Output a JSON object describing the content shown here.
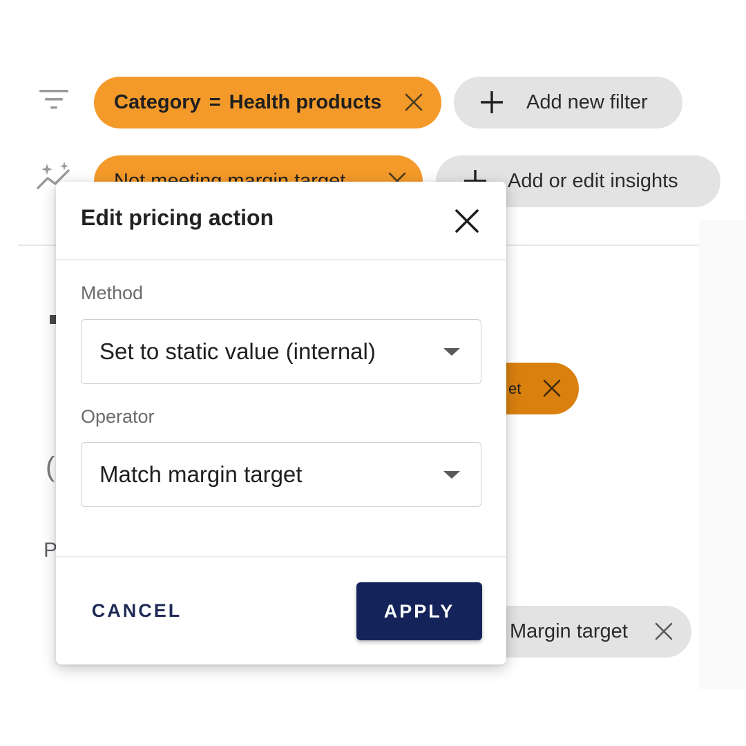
{
  "filters": {
    "chips": [
      {
        "field": "Category",
        "operator": "=",
        "value": "Health products"
      }
    ],
    "add_label": "Add new filter"
  },
  "insights": {
    "chips": [
      {
        "label": "Not meeting margin target"
      }
    ],
    "add_label": "Add or edit insights"
  },
  "background": {
    "chip_fragment": "et",
    "margin_chip_label": "Margin target",
    "letter_p": "P",
    "letter_c": "("
  },
  "dialog": {
    "title": "Edit pricing action",
    "method_label": "Method",
    "method_value": "Set to static value (internal)",
    "operator_label": "Operator",
    "operator_value": "Match margin target",
    "cancel_label": "CANCEL",
    "apply_label": "APPLY"
  },
  "colors": {
    "chip_orange": "#f49a2a",
    "chip_dark_orange": "#d9800f",
    "chip_gray": "#e3e3e3",
    "apply_bg": "#14245a",
    "cancel_text": "#1e2a55"
  }
}
